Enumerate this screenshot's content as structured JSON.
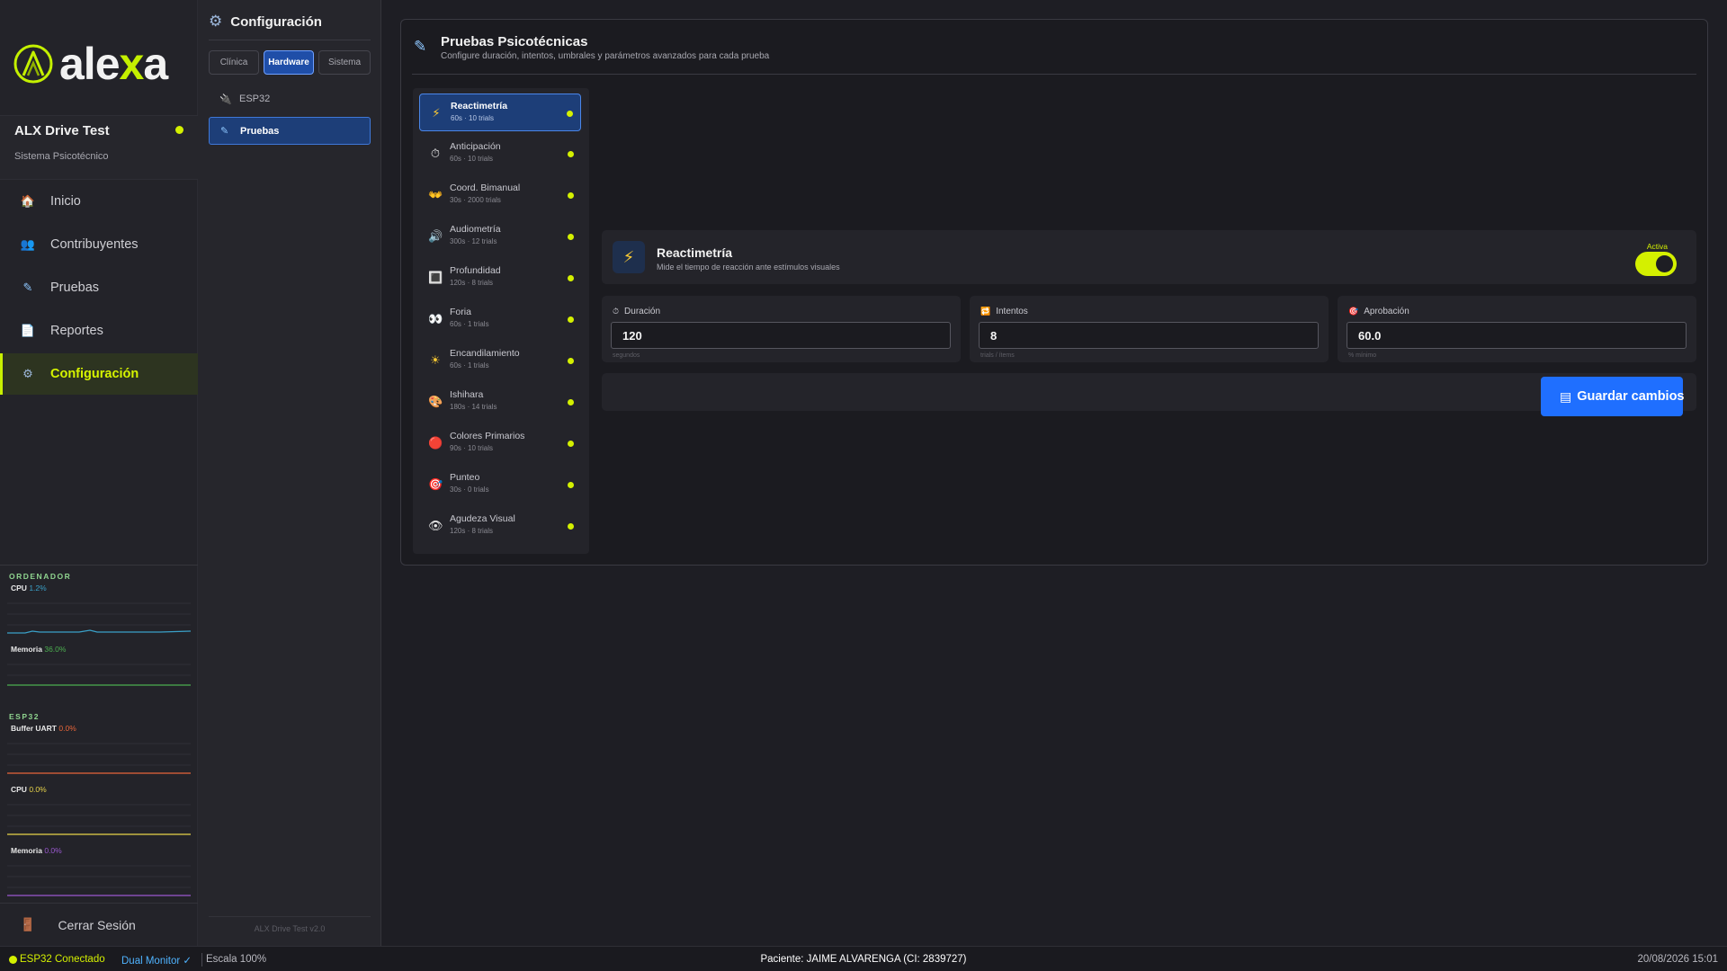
{
  "logo": {
    "text_before": "ale",
    "text_accent": "x",
    "text_after": "a"
  },
  "app": {
    "name": "ALX Drive Test",
    "subtitle": "Sistema Psicotécnico"
  },
  "nav": [
    {
      "label": "Inicio",
      "icon": "home-icon"
    },
    {
      "label": "Contribuyentes",
      "icon": "users-icon"
    },
    {
      "label": "Pruebas",
      "icon": "pencil-icon"
    },
    {
      "label": "Reportes",
      "icon": "document-icon"
    },
    {
      "label": "Configuración",
      "icon": "gear-icon",
      "active": true
    }
  ],
  "monitor": {
    "ordenador_title": "ORDENADOR",
    "cpu_label": "CPU",
    "cpu_value": "1.2%",
    "mem_label": "Memoria",
    "mem_value": "36.0%",
    "esp32_title": "ESP32",
    "uart_label": "Buffer UART",
    "uart_value": "0.0%",
    "esp_cpu_label": "CPU",
    "esp_cpu_value": "0.0%",
    "esp_mem_label": "Memoria",
    "esp_mem_value": "0.0%",
    "colors": {
      "cpu": "#3aa0c8",
      "mem": "#4caf50",
      "uart": "#e8663a",
      "esp_cpu": "#e8d44a",
      "esp_mem": "#9b59d0"
    }
  },
  "logout": {
    "label": "Cerrar Sesión"
  },
  "config_panel": {
    "title": "Configuración",
    "tabs": [
      {
        "label": "Clínica"
      },
      {
        "label": "Hardware",
        "active": true
      },
      {
        "label": "Sistema"
      }
    ],
    "items": [
      {
        "label": "ESP32",
        "icon": "plug-icon"
      },
      {
        "label": "Pruebas",
        "icon": "pencil-icon",
        "active": true
      }
    ],
    "version": "ALX Drive Test v2.0"
  },
  "main": {
    "title": "Pruebas Psicotécnicas",
    "subtitle": "Configure duración, intentos, umbrales y parámetros avanzados para cada prueba"
  },
  "tests": [
    {
      "name": "Reactimetría",
      "meta": "60s · 10 trials",
      "icon": "⚡",
      "active": true
    },
    {
      "name": "Anticipación",
      "meta": "60s · 10 trials",
      "icon": "⏱"
    },
    {
      "name": "Coord. Bimanual",
      "meta": "30s · 2000 trials",
      "icon": "👐"
    },
    {
      "name": "Audiometría",
      "meta": "300s · 12 trials",
      "icon": "🔊"
    },
    {
      "name": "Profundidad",
      "meta": "120s · 8 trials",
      "icon": "🔳"
    },
    {
      "name": "Foria",
      "meta": "60s · 1 trials",
      "icon": "👀"
    },
    {
      "name": "Encandilamiento",
      "meta": "60s · 1 trials",
      "icon": "☀"
    },
    {
      "name": "Ishihara",
      "meta": "180s · 14 trials",
      "icon": "🎨"
    },
    {
      "name": "Colores Primarios",
      "meta": "90s · 10 trials",
      "icon": "🔴"
    },
    {
      "name": "Punteo",
      "meta": "30s · 0 trials",
      "icon": "🎯"
    },
    {
      "name": "Agudeza Visual",
      "meta": "120s · 8 trials",
      "icon": "👁"
    }
  ],
  "detail": {
    "title": "Reactimetría",
    "subtitle": "Mide el tiempo de reacción ante estímulos visuales",
    "status_label": "Activa",
    "active": true,
    "params": [
      {
        "label": "Duración",
        "value": "120",
        "hint": "segundos",
        "icon": "⏱"
      },
      {
        "label": "Intentos",
        "value": "8",
        "hint": "trials / ítems",
        "icon": "🔁"
      },
      {
        "label": "Aprobación",
        "value": "60.0",
        "hint": "% mínimo",
        "icon": "🎯"
      }
    ],
    "save_label": "Guardar cambios"
  },
  "statusbar": {
    "esp": "ESP32 Conectado",
    "dual": "Dual Monitor ✓",
    "scale": "Escala 100%",
    "patient": "Paciente: JAIME ALVARENGA (CI: 2839727)",
    "datetime": "20/08/2026 15:01"
  }
}
